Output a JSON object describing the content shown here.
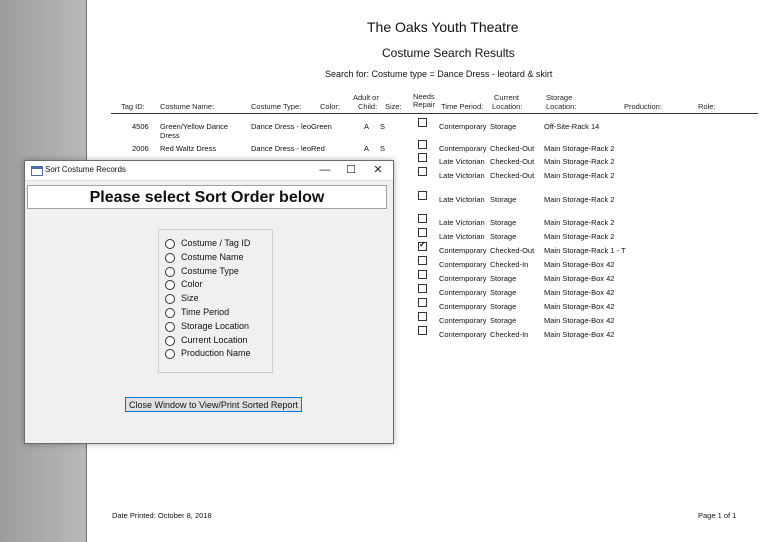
{
  "report": {
    "org_title": "The Oaks Youth Theatre",
    "report_title": "Costume Search Results",
    "search_criteria": "Search for: Costume type =  Dance Dress - leotard & skirt",
    "headers": {
      "tag_id": "Tag ID:",
      "costume_name": "Costume Name:",
      "costume_type": "Costume Type:",
      "color": "Color:",
      "adult_child_1": "Adult or",
      "adult_child_2": "Child:",
      "size": "Size:",
      "needs_repair_1": "Needs",
      "needs_repair_2": "Repair",
      "time_period": "Time Period:",
      "current_location_1": "Current",
      "current_location_2": "Location:",
      "storage_location_1": "Storage",
      "storage_location_2": "Location:",
      "production": "Production:",
      "role": "Role:"
    },
    "rows": [
      {
        "tag": "4506",
        "name1": "Green/Yellow Dance",
        "name2": "Dress",
        "type": "Dance Dress - leo",
        "color": "Green",
        "ac": "A",
        "size": "S",
        "repair": false,
        "period": "Contemporary",
        "current": "Storage",
        "storage": "Off-Site-Rack 14"
      },
      {
        "tag": "2006",
        "name1": "Red Waltz Dress",
        "name2": "",
        "type": "Dance Dress - leo",
        "color": "Red",
        "ac": "A",
        "size": "S",
        "repair": false,
        "period": "Contemporary",
        "current": "Checked-Out",
        "storage": "Main Storage-Rack 2"
      },
      {
        "repair": false,
        "period": "Late Victorian",
        "current": "Checked-Out",
        "storage": "Main Storage-Rack 2"
      },
      {
        "repair": false,
        "period": "Late Victorian",
        "current": "Checked-Out",
        "storage": "Main Storage-Rack 2"
      },
      {
        "repair": false,
        "period": "Late Victorian",
        "current": "Storage",
        "storage": "Main Storage-Rack 2"
      },
      {
        "repair": false,
        "period": "Late Victorian",
        "current": "Storage",
        "storage": "Main Storage-Rack 2"
      },
      {
        "repair": false,
        "period": "Late Victorian",
        "current": "Storage",
        "storage": "Main Storage-Rack 2"
      },
      {
        "repair": true,
        "period": "Contemporary",
        "current": "Checked-Out",
        "storage": "Main Storage-Rack 1 - T"
      },
      {
        "repair": false,
        "period": "Contemporary",
        "current": "Checked-In",
        "storage": "Main Storage-Box 42"
      },
      {
        "repair": false,
        "period": "Contemporary",
        "current": "Storage",
        "storage": "Main Storage-Box 42"
      },
      {
        "repair": false,
        "period": "Contemporary",
        "current": "Storage",
        "storage": "Main Storage-Box 42"
      },
      {
        "repair": false,
        "period": "Contemporary",
        "current": "Storage",
        "storage": "Main Storage-Box 42"
      },
      {
        "repair": false,
        "period": "Contemporary",
        "current": "Storage",
        "storage": "Main Storage-Box 42"
      },
      {
        "repair": false,
        "period": "Contemporary",
        "current": "Checked-In",
        "storage": "Main Storage-Box 42"
      }
    ],
    "footer": {
      "date_printed": "Date Printed: October 8, 2018",
      "page": "Page 1 of 1"
    }
  },
  "dialog": {
    "title": "Sort Costume Records",
    "window_buttons": {
      "minimize": "—",
      "maximize": "☐",
      "close": "✕"
    },
    "heading": "Please select Sort Order below",
    "options": [
      "Costume / Tag ID",
      "Costume Name",
      "Costume Type",
      "Color",
      "Size",
      "Time Period",
      "Storage Location",
      "Current Location",
      "Production Name"
    ],
    "close_button_label": "Close Window to View/Print Sorted Report"
  }
}
